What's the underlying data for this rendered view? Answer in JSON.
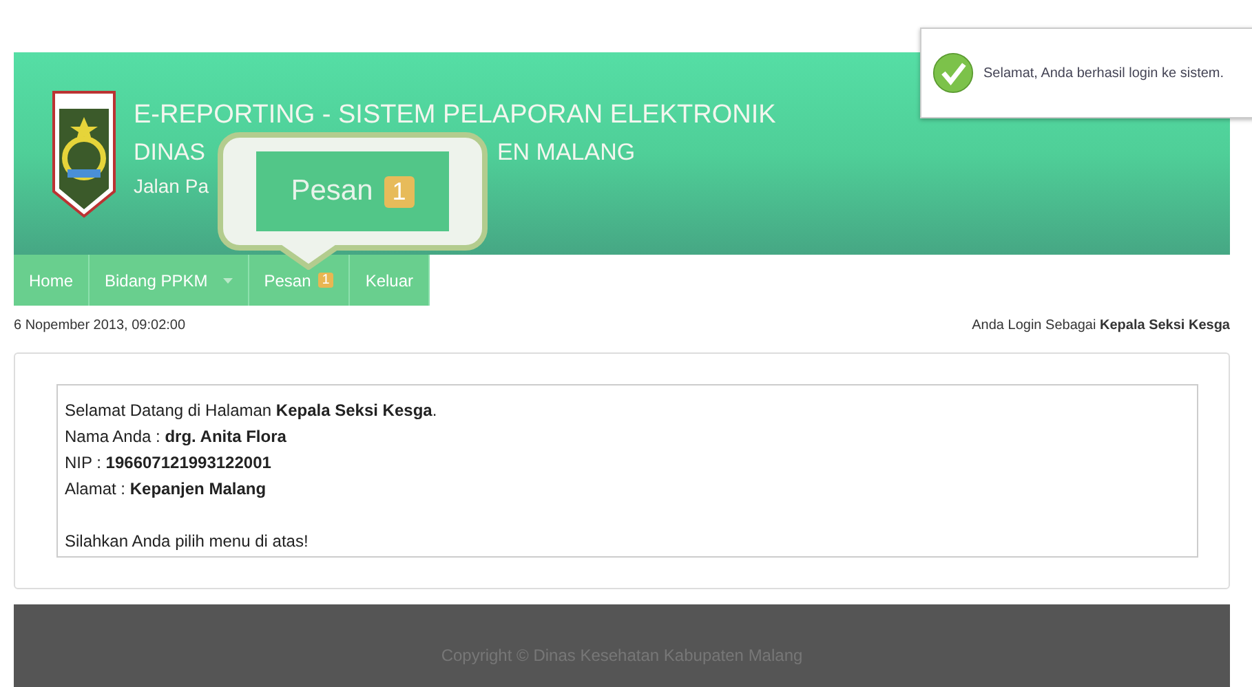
{
  "header": {
    "title": "E-REPORTING - SISTEM PELAPORAN ELEKTRONIK",
    "line_2": [
      "DINAS",
      "EN MALANG"
    ],
    "line_3": [
      "Jalan Pa"
    ]
  },
  "callout": {
    "label": "Pesan",
    "badge": "1"
  },
  "toast": {
    "message": "Selamat, Anda berhasil login ke sistem."
  },
  "nav": [
    {
      "label": "Home",
      "dropdown": false
    },
    {
      "label": "Bidang PPKM",
      "dropdown": true
    },
    {
      "label": "Pesan",
      "badge": "1",
      "dropdown": false
    },
    {
      "label": "Keluar",
      "dropdown": false
    }
  ],
  "info_bar": {
    "date": "6 Nopember 2013, 09:02:00",
    "login": "Anda Login Sebagai **Kepala Seksi Kesga**"
  },
  "welcome": [
    "Selamat Datang di Halaman **Kepala Seksi Kesga**.",
    "Nama Anda : **drg. Anita Flora**",
    "NIP : **196607121993122001**",
    "Alamat : **Kepanjen Malang**"
  ],
  "instruction": "Silahkan Anda pilih menu di atas!",
  "footer": "Copyright © Dinas Kesehatan Kabupaten Malang"
}
